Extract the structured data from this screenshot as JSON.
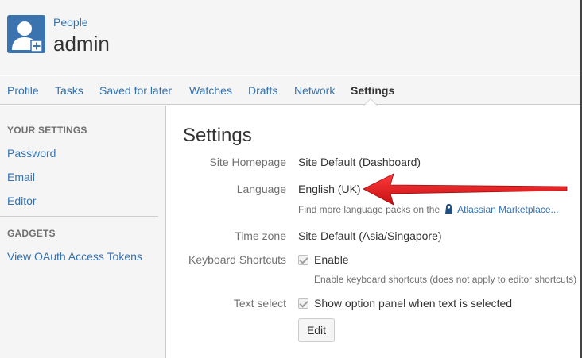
{
  "header": {
    "breadcrumb": "People",
    "title": "admin"
  },
  "tabs": [
    {
      "label": "Profile",
      "active": false
    },
    {
      "label": "Tasks",
      "active": false
    },
    {
      "label": "Saved for later",
      "active": false
    },
    {
      "label": "Watches",
      "active": false
    },
    {
      "label": "Drafts",
      "active": false
    },
    {
      "label": "Network",
      "active": false
    },
    {
      "label": "Settings",
      "active": true
    }
  ],
  "sidebar": {
    "your_settings_heading": "YOUR SETTINGS",
    "your_settings_items": [
      "Password",
      "Email",
      "Editor"
    ],
    "gadgets_heading": "GADGETS",
    "gadgets_items": [
      "View OAuth Access Tokens"
    ]
  },
  "settings": {
    "title": "Settings",
    "site_homepage": {
      "label": "Site Homepage",
      "value": "Site Default (Dashboard)"
    },
    "language": {
      "label": "Language",
      "value": "English (UK)",
      "hint_prefix": "Find more language packs on the",
      "hint_link": "Atlassian Marketplace..."
    },
    "time_zone": {
      "label": "Time zone",
      "value": "Site Default (Asia/Singapore)"
    },
    "keyboard_shortcuts": {
      "label": "Keyboard Shortcuts",
      "checkbox_label": "Enable",
      "checked": true,
      "hint": "Enable keyboard shortcuts (does not apply to editor shortcuts)"
    },
    "text_select": {
      "label": "Text select",
      "checkbox_label": "Show option panel when text is selected",
      "checked": true
    },
    "edit_label": "Edit"
  },
  "colors": {
    "link": "#3572b0",
    "annotation_arrow": "#e8161b",
    "avatar_bg": "#3b73af"
  },
  "icons": {
    "avatar": "user-add-icon",
    "marketplace": "atlassian-marketplace-icon",
    "annotation": "red-arrow-icon"
  }
}
